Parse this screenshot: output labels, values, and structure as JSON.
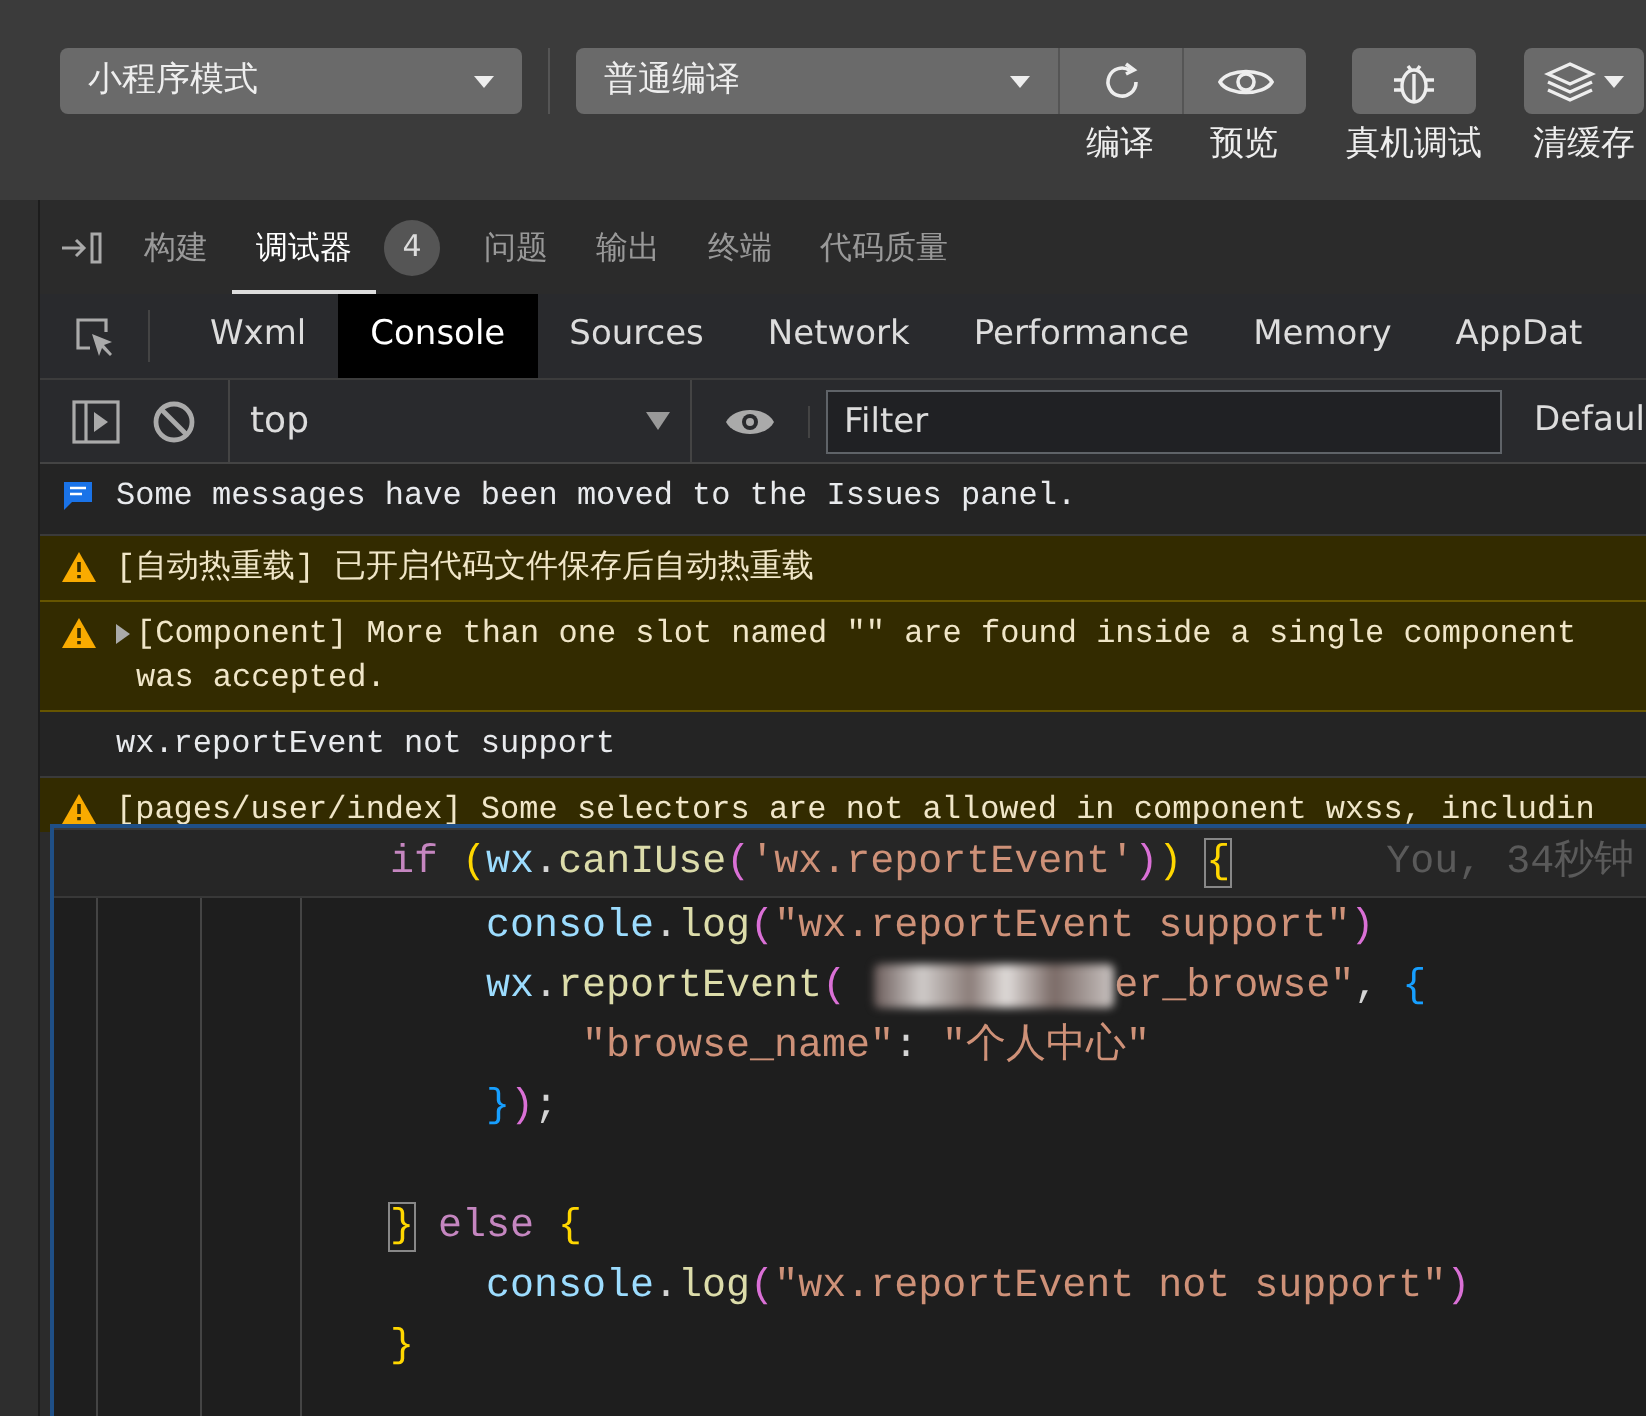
{
  "toolbar": {
    "mode_dropdown": "小程序模式",
    "compile_dropdown": "普通编译",
    "actions": [
      {
        "kind": "refresh",
        "label": "编译"
      },
      {
        "kind": "preview",
        "label": "预览"
      },
      {
        "kind": "debug",
        "label": "真机调试"
      },
      {
        "kind": "cache",
        "label": "清缓存"
      }
    ]
  },
  "panel_tabs": [
    {
      "label": "构建",
      "selected": false
    },
    {
      "label": "调试器",
      "selected": true,
      "badge": "4"
    },
    {
      "label": "问题",
      "selected": false
    },
    {
      "label": "输出",
      "selected": false
    },
    {
      "label": "终端",
      "selected": false
    },
    {
      "label": "代码质量",
      "selected": false
    }
  ],
  "devtools_tabs": [
    {
      "label": "Wxml",
      "selected": false
    },
    {
      "label": "Console",
      "selected": true
    },
    {
      "label": "Sources",
      "selected": false
    },
    {
      "label": "Network",
      "selected": false
    },
    {
      "label": "Performance",
      "selected": false
    },
    {
      "label": "Memory",
      "selected": false
    },
    {
      "label": "AppDat",
      "selected": false
    }
  ],
  "console_toolbar": {
    "context": "top",
    "filter_placeholder": "Filter",
    "levels": "Defaul"
  },
  "messages": [
    {
      "kind": "info",
      "expandable": false,
      "text": "Some messages have been moved to the Issues panel."
    },
    {
      "kind": "warning",
      "expandable": false,
      "text": "[自动热重载] 已开启代码文件保存后自动热重载"
    },
    {
      "kind": "warning",
      "expandable": true,
      "text": "[Component] More than one slot named \"\" are found inside a single component was accepted."
    },
    {
      "kind": "log",
      "expandable": false,
      "text": "wx.reportEvent not support"
    },
    {
      "kind": "warning",
      "expandable": false,
      "text": "[pages/user/index] Some selectors are not allowed in component wxss, includin"
    }
  ],
  "editor": {
    "lines": [
      {
        "current": true,
        "tokens": [
          {
            "kind": "keyword",
            "text": "if "
          },
          {
            "kind": "bracket1",
            "text": "("
          },
          {
            "kind": "variable",
            "text": "wx"
          },
          {
            "kind": "plain",
            "text": "."
          },
          {
            "kind": "function",
            "text": "canIUse"
          },
          {
            "kind": "bracket2",
            "text": "("
          },
          {
            "kind": "string",
            "text": "'wx.reportEvent'"
          },
          {
            "kind": "bracket2",
            "text": ")"
          },
          {
            "kind": "bracket1",
            "text": ") "
          },
          {
            "kind": "matched-bracket1",
            "text": "{"
          },
          {
            "kind": "blame",
            "text": "You, 34秒钟"
          }
        ],
        "children": [
          {
            "current": false,
            "tokens": [
              {
                "kind": "variable",
                "text": "console"
              },
              {
                "kind": "plain",
                "text": "."
              },
              {
                "kind": "function",
                "text": "log"
              },
              {
                "kind": "bracket2",
                "text": "("
              },
              {
                "kind": "string",
                "text": "\"wx.reportEvent support\""
              },
              {
                "kind": "bracket2",
                "text": ")"
              }
            ]
          },
          {
            "current": false,
            "tokens": [
              {
                "kind": "variable",
                "text": "wx"
              },
              {
                "kind": "plain",
                "text": "."
              },
              {
                "kind": "function",
                "text": "reportEvent"
              },
              {
                "kind": "bracket2",
                "text": "("
              },
              {
                "kind": "redacted"
              },
              {
                "kind": "string",
                "text": "er_browse\""
              },
              {
                "kind": "plain",
                "text": ", "
              },
              {
                "kind": "bracket3",
                "text": "{"
              }
            ],
            "children": [
              {
                "current": false,
                "tokens": [
                  {
                    "kind": "string",
                    "text": "\"browse_name\""
                  },
                  {
                    "kind": "plain",
                    "text": ": "
                  },
                  {
                    "kind": "string",
                    "text": "\"个人中心\""
                  }
                ]
              }
            ]
          },
          {
            "current": false,
            "tokens": [
              {
                "kind": "bracket3",
                "text": "}"
              },
              {
                "kind": "bracket2",
                "text": ")"
              },
              {
                "kind": "plain",
                "text": ";"
              }
            ]
          }
        ]
      },
      {
        "current": false,
        "tokens": [
          {
            "kind": "matched-bracket1",
            "text": "} "
          },
          {
            "kind": "keyword",
            "text": "else "
          },
          {
            "kind": "bracket1",
            "text": "{"
          }
        ],
        "children": [
          {
            "current": false,
            "tokens": [
              {
                "kind": "variable",
                "text": "console"
              },
              {
                "kind": "plain",
                "text": "."
              },
              {
                "kind": "function",
                "text": "log"
              },
              {
                "kind": "bracket2",
                "text": "("
              },
              {
                "kind": "string",
                "text": "\"wx.reportEvent not support\""
              },
              {
                "kind": "bracket2",
                "text": ")"
              }
            ]
          }
        ]
      },
      {
        "current": false,
        "tokens": [
          {
            "kind": "bracket1",
            "text": "}"
          }
        ]
      }
    ]
  }
}
